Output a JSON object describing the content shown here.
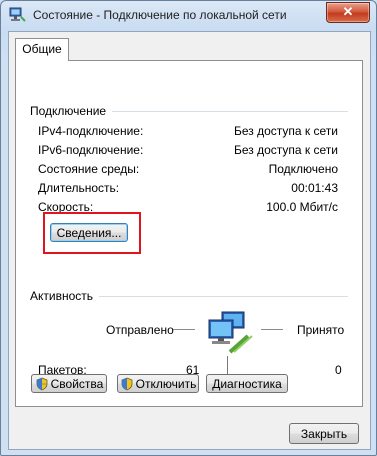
{
  "window": {
    "title": "Состояние - Подключение по локальной сети",
    "close_glyph": "✕"
  },
  "tabs": [
    {
      "label": "Общие",
      "selected": true
    }
  ],
  "connection": {
    "group_label": "Подключение",
    "rows": [
      {
        "label": "IPv4-подключение:",
        "value": "Без доступа к сети"
      },
      {
        "label": "IPv6-подключение:",
        "value": "Без доступа к сети"
      },
      {
        "label": "Состояние среды:",
        "value": "Подключено"
      },
      {
        "label": "Длительность:",
        "value": "00:01:43"
      },
      {
        "label": "Скорость:",
        "value": "100.0 Мбит/с"
      }
    ],
    "details_button": "Сведения..."
  },
  "activity": {
    "group_label": "Активность",
    "sent_label": "Отправлено",
    "received_label": "Принято",
    "packets_label": "Пакетов:",
    "packets_sent": "61",
    "packets_received": "0"
  },
  "buttons": {
    "properties": "Свойства",
    "disable": "Отключить",
    "diagnose": "Диагностика",
    "close": "Закрыть"
  },
  "colors": {
    "highlight_frame": "#e0141e",
    "title_bar": "#cfe0f3"
  },
  "icons": {
    "title": "network-connection-icon",
    "activity": "network-computers-icon",
    "uac": "uac-shield-icon"
  }
}
